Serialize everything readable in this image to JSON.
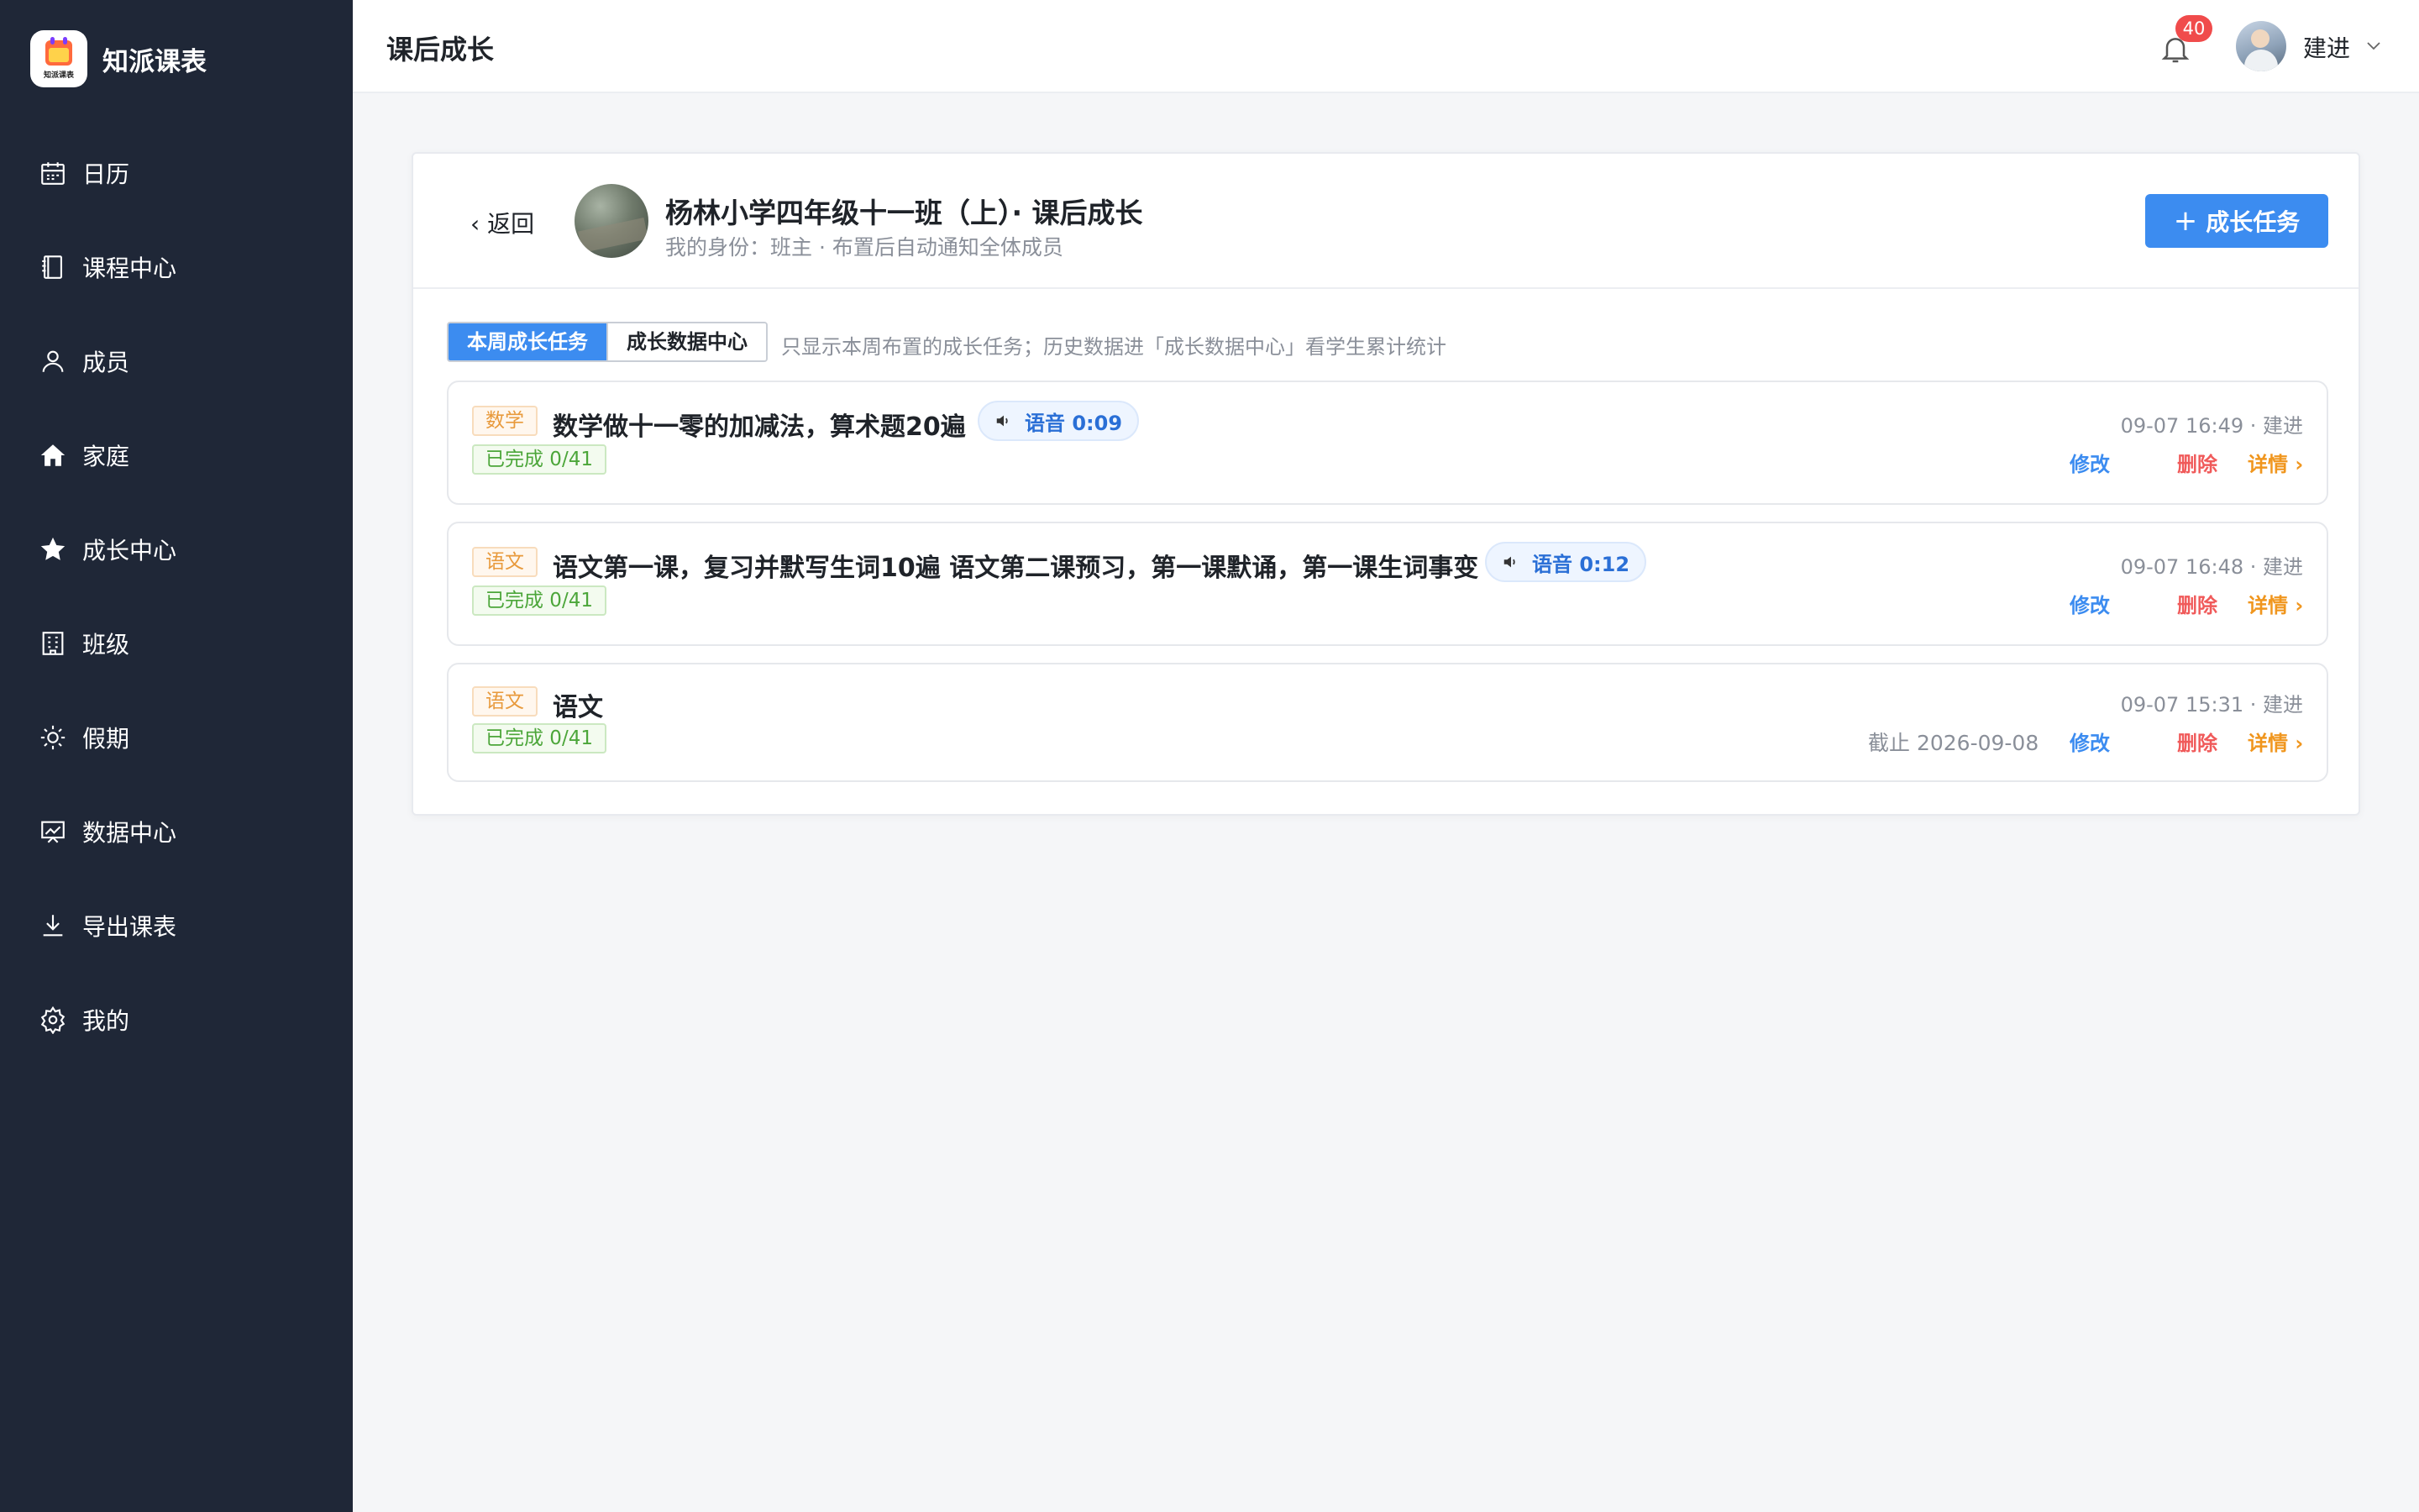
{
  "app": {
    "name": "知派课表",
    "logo_text": "知派课表"
  },
  "sidebar": {
    "items": [
      {
        "label": "日历",
        "icon": "calendar-icon"
      },
      {
        "label": "课程中心",
        "icon": "book-icon"
      },
      {
        "label": "成员",
        "icon": "user-icon"
      },
      {
        "label": "家庭",
        "icon": "home-icon"
      },
      {
        "label": "成长中心",
        "icon": "star-icon"
      },
      {
        "label": "班级",
        "icon": "building-icon"
      },
      {
        "label": "假期",
        "icon": "sun-icon"
      },
      {
        "label": "数据中心",
        "icon": "chart-icon"
      },
      {
        "label": "导出课表",
        "icon": "download-icon"
      },
      {
        "label": "我的",
        "icon": "gear-icon"
      }
    ]
  },
  "header": {
    "title": "课后成长",
    "notification_count": "40",
    "user_name": "建进"
  },
  "class_card": {
    "back_label": "返回",
    "title": "杨林小学四年级十一班（上）· 课后成长",
    "subtitle": "我的身份：班主 · 布置后自动通知全体成员",
    "add_button": "成长任务",
    "tabs": [
      "本周成长任务",
      "成长数据中心"
    ],
    "active_tab": 0,
    "hint": "只显示本周布置的成长任务；历史数据进「成长数据中心」看学生累计统计"
  },
  "tasks": [
    {
      "subject": "数学",
      "title": "数学做十一零的加减法，算术题20遍",
      "voice": "语音 0:09",
      "done": "已完成 0/41",
      "meta": "09-07 16:49 · 建进",
      "deadline": "",
      "edit": "修改",
      "delete": "删除",
      "detail": "详情 ›"
    },
    {
      "subject": "语文",
      "title": "语文第一课，复习并默写生词10遍 语文第二课预习，第一课默诵，第一课生词事变",
      "voice": "语音 0:12",
      "done": "已完成 0/41",
      "meta": "09-07 16:48 · 建进",
      "deadline": "",
      "edit": "修改",
      "delete": "删除",
      "detail": "详情 ›"
    },
    {
      "subject": "语文",
      "title": "语文",
      "voice": "",
      "done": "已完成 0/41",
      "meta": "09-07 15:31 · 建进",
      "deadline": "截止 2026-09-08",
      "edit": "修改",
      "delete": "删除",
      "detail": "详情 ›"
    }
  ],
  "colors": {
    "sidebar_bg": "#1f2737",
    "primary": "#3c8cf0",
    "danger": "#f05a5a",
    "warning": "#f0961e",
    "success": "#4ca63a"
  }
}
